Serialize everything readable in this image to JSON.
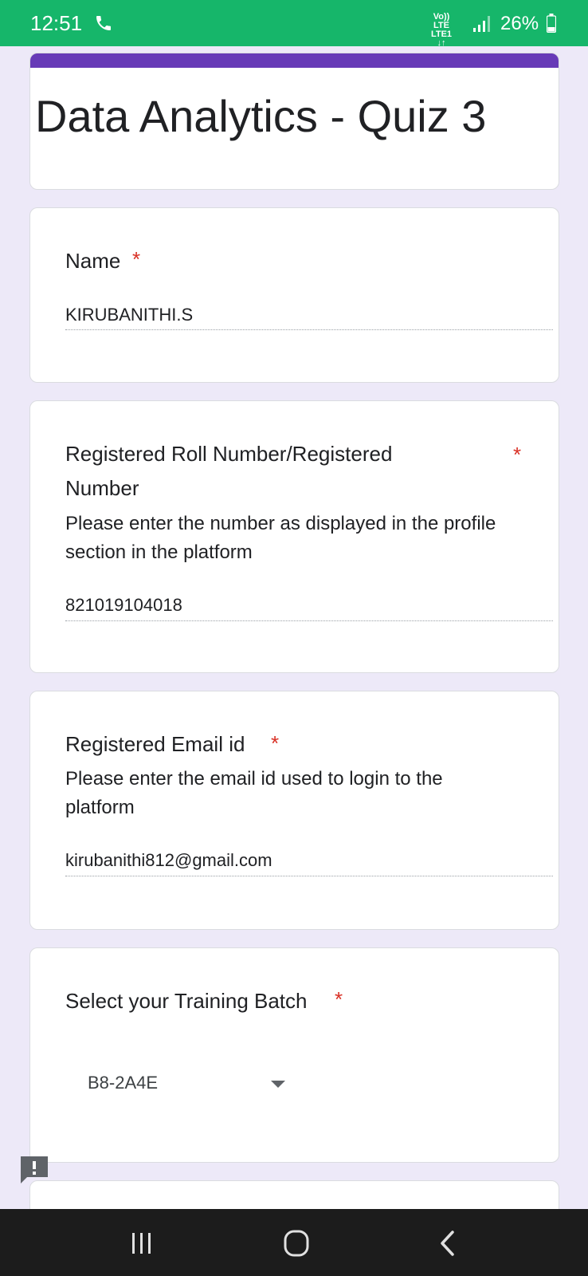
{
  "status_bar": {
    "time": "12:51",
    "network_line1": "Vo)) LTE",
    "network_line2": "LTE1 ↓↑",
    "battery": "26%",
    "bg_color": "#16b66a"
  },
  "form": {
    "title": "Data Analytics - Quiz 3",
    "accent_color": "#673ab7"
  },
  "questions": [
    {
      "title": "Name",
      "required_mark": "*",
      "answer": "KIRUBANITHI.S"
    },
    {
      "title_line1": "Registered Roll Number/Registered",
      "title_line2": "Number",
      "required_mark": "*",
      "description": "Please enter the number as displayed in the profile section in the platform",
      "answer": "821019104018"
    },
    {
      "title": "Registered Email id",
      "required_mark": "*",
      "description": "Please enter the email id used to login to the platform",
      "answer": "kirubanithi812@gmail.com"
    },
    {
      "title": "Select your Training Batch",
      "required_mark": "*",
      "selected_value": "B8-2A4E"
    }
  ],
  "icons": {
    "phone": "phone-icon",
    "signal": "signal-icon",
    "battery": "battery-icon",
    "feedback": "feedback-icon",
    "dropdown": "chevron-down-icon",
    "recents": "recents-icon",
    "home": "home-icon",
    "back": "back-icon"
  }
}
